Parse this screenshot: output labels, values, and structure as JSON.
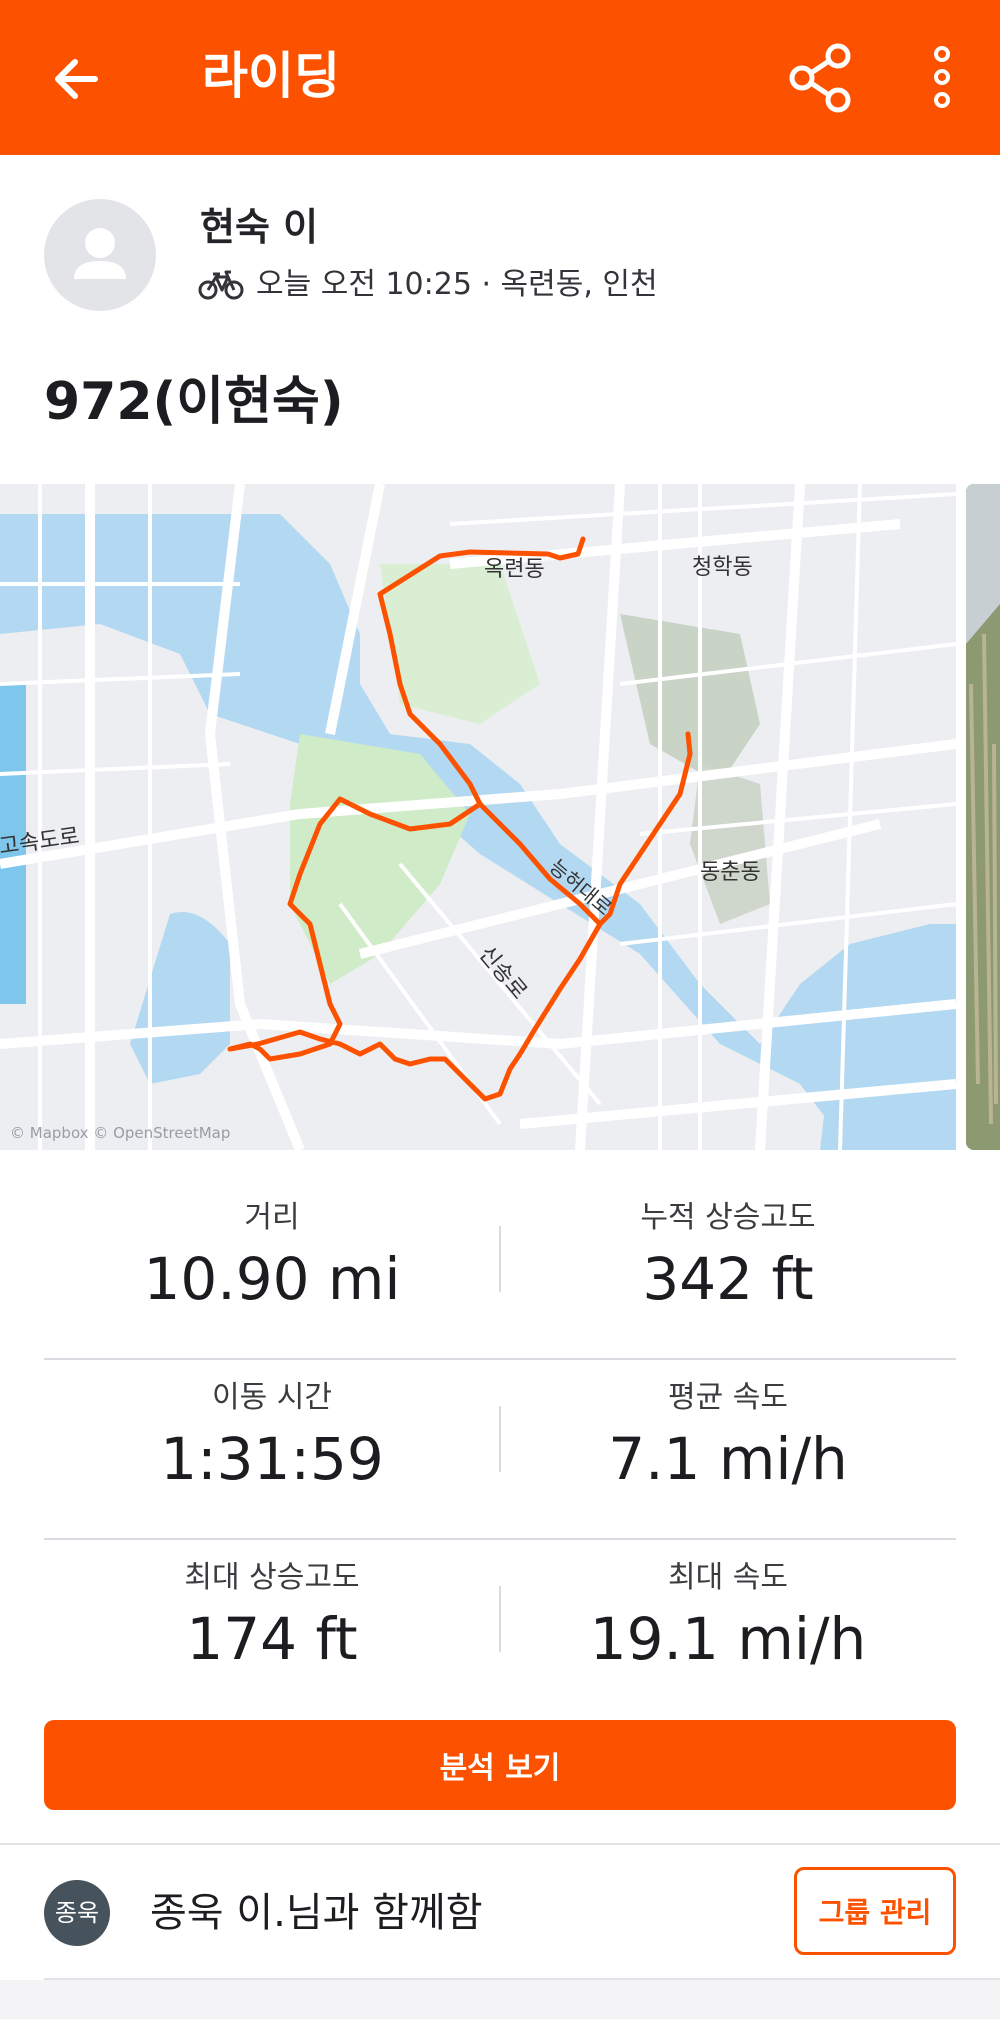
{
  "app_bar": {
    "title": "라이딩",
    "back_icon": "arrow-left-icon",
    "share_icon": "share-icon",
    "more_icon": "more-vertical-icon",
    "background_color": "#fc5200"
  },
  "athlete": {
    "name": "현숙 이",
    "activity_icon": "bike-icon",
    "meta": "오늘 오전 10:25 · 옥련동, 인천"
  },
  "activity": {
    "title": "972(이현숙)"
  },
  "map": {
    "labels": {
      "okryeon": "옥련동",
      "cheonghak": "청학동",
      "dongchun": "동춘동",
      "expressway": "고속도로",
      "sinsong": "신송로",
      "road": "능허대로"
    },
    "attribution": "© Mapbox © OpenStreetMap",
    "route_color": "#fc5200"
  },
  "stats": [
    {
      "label": "거리",
      "value": "10.90 mi"
    },
    {
      "label": "누적 상승고도",
      "value": "342 ft"
    },
    {
      "label": "이동 시간",
      "value": "1:31:59"
    },
    {
      "label": "평균 속도",
      "value": "7.1 mi/h"
    },
    {
      "label": "최대 상승고도",
      "value": "174 ft"
    },
    {
      "label": "최대 속도",
      "value": "19.1 mi/h"
    }
  ],
  "analysis_button": "분석 보기",
  "group": {
    "avatar_text": "종욱",
    "text": "종욱 이.님과 함께함",
    "manage_button": "그룹 관리"
  }
}
